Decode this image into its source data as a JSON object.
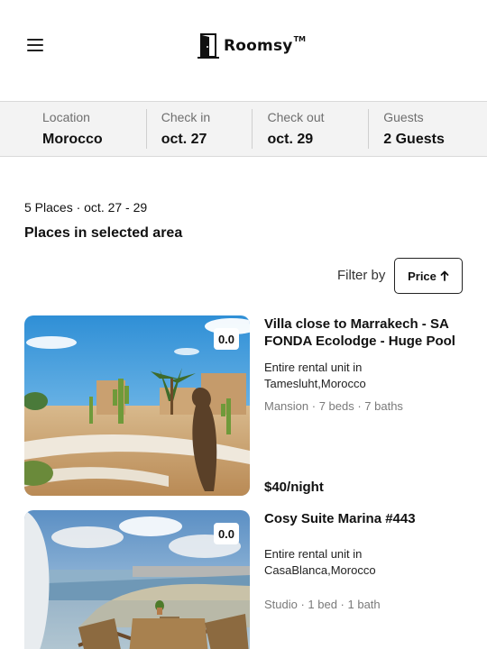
{
  "header": {
    "menu_icon": "hamburger-menu-icon",
    "logo_icon": "door-icon",
    "brand": "Roomsy",
    "trademark": "TM"
  },
  "search": {
    "location": {
      "label": "Location",
      "value": "Morocco"
    },
    "check_in": {
      "label": "Check in",
      "value": "oct. 27"
    },
    "check_out": {
      "label": "Check out",
      "value": "oct. 29"
    },
    "guests": {
      "label": "Guests",
      "value": "2 Guests"
    }
  },
  "results": {
    "summary": "5 Places · oct. 27 - 29",
    "title": "Places in selected area"
  },
  "filter": {
    "label": "Filter by",
    "button_label": "Price",
    "sort_icon": "arrow-up-icon"
  },
  "listings": [
    {
      "rating": "0.0",
      "title": "Villa close to Marrakech - SA FONDA Ecolodge - Huge Pool",
      "type": "Entire rental unit in Tamesluht,Morocco",
      "specs": "Mansion · 7 beds · 7 baths",
      "price": "$40/night"
    },
    {
      "rating": "0.0",
      "title": "Cosy Suite Marina #443",
      "type": "Entire rental unit in CasaBlanca,Morocco",
      "specs": "Studio · 1 bed · 1 bath"
    }
  ],
  "colors": {
    "searchbar_bg": "#f3f3f3",
    "text": "#111111",
    "muted": "#7a7a7a"
  }
}
